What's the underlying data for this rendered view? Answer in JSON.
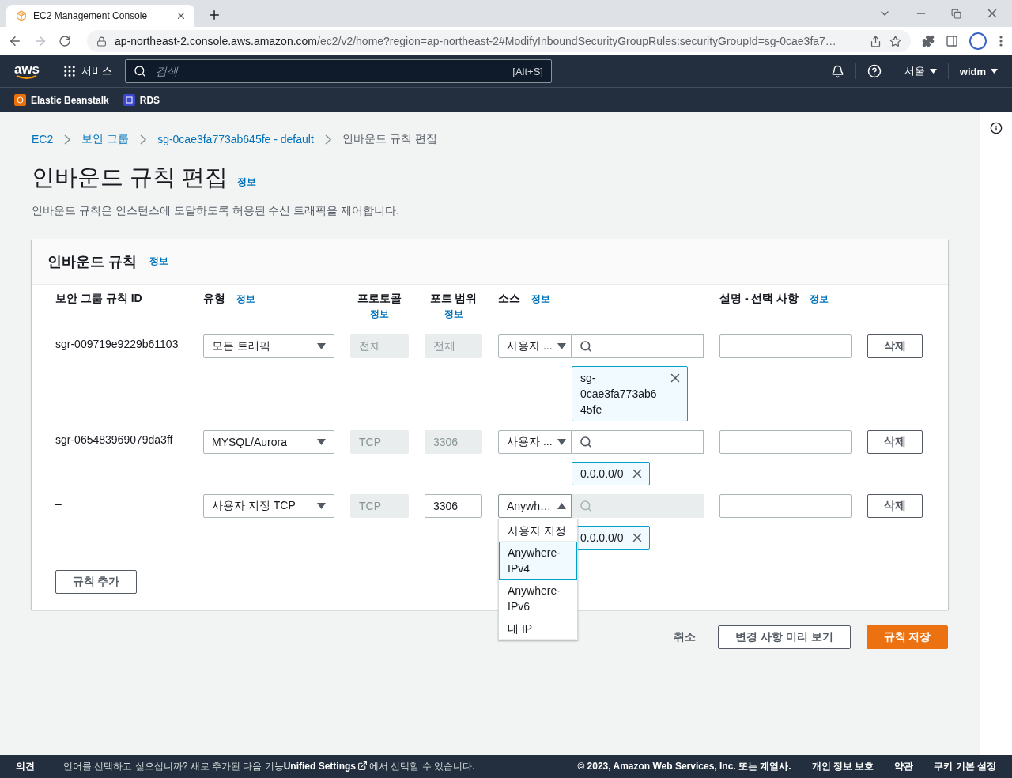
{
  "browser": {
    "tab_title": "EC2 Management Console",
    "url_host": "ap-northeast-2.console.aws.amazon.com",
    "url_path": "/ec2/v2/home?region=ap-northeast-2#ModifyInboundSecurityGroupRules:securityGroupId=sg-0cae3fa7…"
  },
  "top_nav": {
    "logo": "aws",
    "services": "서비스",
    "search_placeholder": "검색",
    "search_shortcut": "[Alt+S]",
    "region": "서울",
    "user": "widm"
  },
  "favorites": [
    {
      "label": "Elastic Beanstalk",
      "kind": "beanstalk"
    },
    {
      "label": "RDS",
      "kind": "rds"
    }
  ],
  "breadcrumb": [
    {
      "label": "EC2",
      "link": true
    },
    {
      "label": "보안 그룹",
      "link": true
    },
    {
      "label": "sg-0cae3fa773ab645fe - default",
      "link": true
    },
    {
      "label": "인바운드 규칙 편집",
      "link": false
    }
  ],
  "page": {
    "title": "인바운드 규칙 편집",
    "info": "정보",
    "description": "인바운드 규칙은 인스턴스에 도달하도록 허용된 수신 트래픽을 제어합니다."
  },
  "panel": {
    "title": "인바운드 규칙",
    "info": "정보",
    "columns": [
      {
        "label": "보안 그룹 규칙 ID"
      },
      {
        "label": "유형",
        "info": "정보"
      },
      {
        "label": "프로토콜",
        "info": "정보"
      },
      {
        "label": "포트 범위",
        "info": "정보"
      },
      {
        "label": "소스",
        "info": "정보"
      },
      {
        "label": "설명 - 선택 사항",
        "info": "정보"
      }
    ],
    "rows": [
      {
        "id": "sgr-009719e9229b61103",
        "type": "모든 트래픽",
        "protocol": "전체",
        "protocol_disabled": true,
        "port": "전체",
        "port_disabled": true,
        "source_type": "사용자 ...",
        "source_open": false,
        "search_disabled": false,
        "tokens": [
          "sg-0cae3fa773ab645fe"
        ],
        "delete": "삭제"
      },
      {
        "id": "sgr-065483969079da3ff",
        "type": "MYSQL/Aurora",
        "protocol": "TCP",
        "protocol_disabled": true,
        "port": "3306",
        "port_disabled": true,
        "source_type": "사용자 ...",
        "source_open": false,
        "search_disabled": false,
        "tokens": [
          "0.0.0.0/0"
        ],
        "delete": "삭제"
      },
      {
        "id": "–",
        "type": "사용자 지정 TCP",
        "protocol": "TCP",
        "protocol_disabled": true,
        "port": "3306",
        "port_disabled": false,
        "source_type": "Anywh…",
        "source_open": true,
        "search_disabled": true,
        "tokens": [
          "0.0.0.0/0"
        ],
        "delete": "삭제",
        "options": [
          {
            "label": "사용자 지정",
            "selected": false
          },
          {
            "label": "Anywhere-IPv4",
            "selected": true
          },
          {
            "label": "Anywhere-IPv6",
            "selected": false
          },
          {
            "label": "내 IP",
            "selected": false
          }
        ]
      }
    ],
    "add_button": "규칙 추가"
  },
  "actions": {
    "cancel": "취소",
    "preview": "변경 사항 미리 보기",
    "save": "규칙 저장"
  },
  "footer": {
    "feedback": "의견",
    "notice_before": "언어를 선택하고 싶으십니까? 새로 추가된 다음 기능",
    "notice_link": "Unified Settings",
    "notice_after": "에서 선택할 수 있습니다.",
    "copyright": "© 2023, Amazon Web Services, Inc. 또는 계열사.",
    "links": [
      "개인 정보 보호",
      "약관",
      "쿠키 기본 설정"
    ]
  }
}
